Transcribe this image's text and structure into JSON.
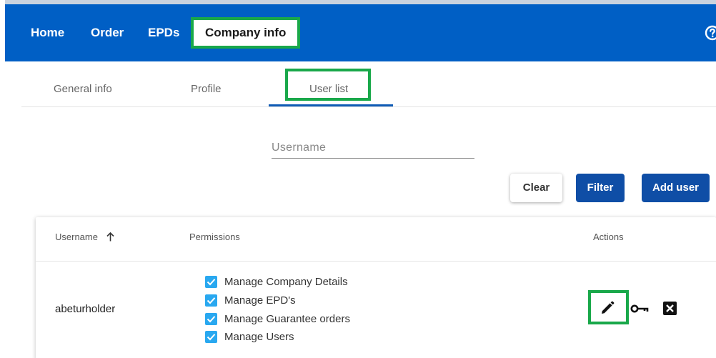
{
  "nav": {
    "items": [
      {
        "label": "Home"
      },
      {
        "label": "Order"
      },
      {
        "label": "EPDs"
      },
      {
        "label": "Company info"
      }
    ],
    "help_icon": "help-circle-icon"
  },
  "tabs": [
    {
      "label": "General info"
    },
    {
      "label": "Profile"
    },
    {
      "label": "User list",
      "active": true
    }
  ],
  "search": {
    "placeholder": "Username",
    "value": ""
  },
  "buttons": {
    "clear": "Clear",
    "filter": "Filter",
    "add_user": "Add user"
  },
  "table": {
    "columns": {
      "username": "Username",
      "permissions": "Permissions",
      "actions": "Actions"
    },
    "sort": {
      "column": "username",
      "direction": "ascending",
      "icon": "arrow-up-icon"
    },
    "rows": [
      {
        "username": "abeturholder",
        "permissions": [
          {
            "label": "Manage Company Details",
            "checked": true
          },
          {
            "label": "Manage EPD's",
            "checked": true
          },
          {
            "label": "Manage Guarantee orders",
            "checked": true
          },
          {
            "label": "Manage Users",
            "checked": true
          }
        ],
        "actions": [
          "edit-icon",
          "key-icon",
          "delete-icon"
        ]
      }
    ]
  },
  "colors": {
    "nav_background": "#005fc5",
    "primary_button": "#0f4ea6",
    "checkbox": "#29a8f0",
    "highlight": "#19a84a"
  }
}
